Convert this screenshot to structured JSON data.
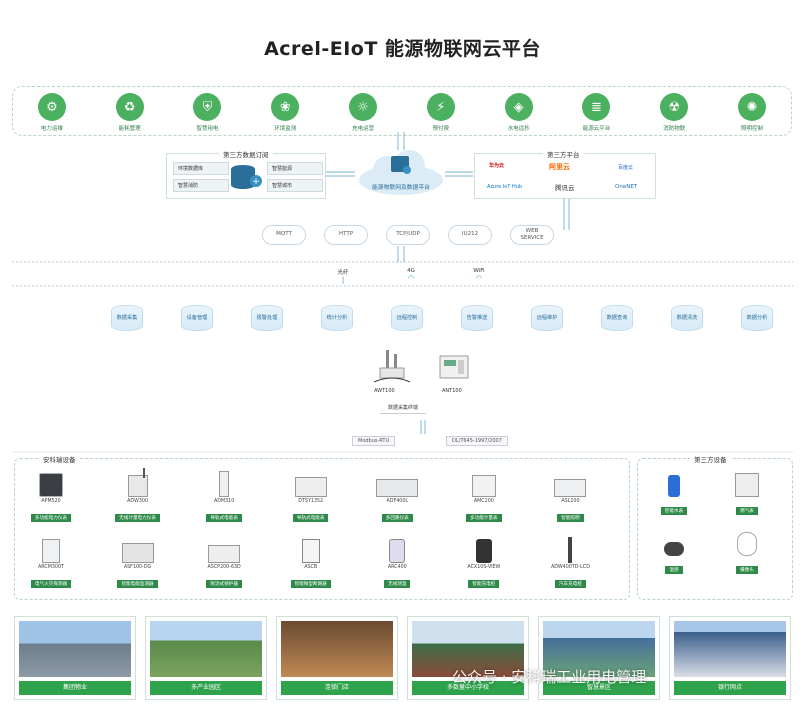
{
  "title": "Acrel-EIoT 能源物联网云平台",
  "apps": [
    "电力运维",
    "能耗管理",
    "智慧用电",
    "环境监测",
    "充电运营",
    "预付费",
    "水电远抄",
    "能源云平台",
    "消防物联",
    "照明控制"
  ],
  "left_panel": {
    "title": "第三方数据订阅",
    "items_left": [
      "环境数据库",
      "智慧消防"
    ],
    "items_right": [
      "智慧能源",
      "智慧城市"
    ]
  },
  "center_cloud": "能源物联网及数据平台",
  "right_panel": {
    "title": "第三方平台",
    "logos": [
      "华为云",
      "阿里云",
      "Azure IoT Hub",
      "腾讯云",
      "百度云",
      "OneNET"
    ]
  },
  "protocols": [
    "MQTT",
    "HTTP",
    "TCP/UDP",
    "IU212",
    "WEB\nSERVICE"
  ],
  "network": [
    "光纤",
    "4G",
    "WiFi"
  ],
  "functions": [
    "数据采集",
    "设备管理",
    "报警处理",
    "统计分析",
    "远程控制",
    "告警推送",
    "远程维护",
    "数据查询",
    "数据清洗",
    "数据分析"
  ],
  "gateways": [
    {
      "model": "AWT100"
    },
    {
      "model": "ANT100"
    }
  ],
  "gateway_label": "数据采集终端",
  "bus_protocols": [
    "Modbus-RTU",
    "DL/T645-1997/2007"
  ],
  "acrel_section": {
    "title": "安科瑞设备",
    "devices": [
      {
        "model": "APM520",
        "name": "多功能电力仪表"
      },
      {
        "model": "ADW300",
        "name": "无线计量电力仪表"
      },
      {
        "model": "ADM310",
        "name": "导轨式电能表"
      },
      {
        "model": "DTSY1352",
        "name": "导轨式电能表"
      },
      {
        "model": "ADF400L",
        "name": "多回路仪表"
      },
      {
        "model": "AMC200",
        "name": "多功能计量表"
      },
      {
        "model": "ASL100",
        "name": "智能照明"
      },
      {
        "model": "ARCM300T",
        "name": "电气火灾探测器"
      },
      {
        "model": "ASF100-DG",
        "name": "智能电能监测器"
      },
      {
        "model": "ASCP200-63D",
        "name": "限流式保护器"
      },
      {
        "model": "ASCB",
        "name": "智能微型断路器"
      },
      {
        "model": "ARC400",
        "name": "无线测温"
      },
      {
        "model": "ACX10S-VIEW",
        "name": "智能充电桩"
      },
      {
        "model": "ADW400TD-LCD",
        "name": "汽车充电桩"
      }
    ]
  },
  "third_section": {
    "title": "第三方设备",
    "devices": [
      "智能水表",
      "燃气表",
      "温感",
      "摄像头"
    ]
  },
  "scenarios": [
    "集团物业",
    "多产业园区",
    "连锁门店",
    "多数量中小学校",
    "智慧景区",
    "银行网点"
  ],
  "watermark": "公众号 · 安科瑞工业用电管理",
  "colors": {
    "green": "#2fa24c",
    "light_green": "#4bb05f",
    "blue": "#2a6f9a"
  }
}
